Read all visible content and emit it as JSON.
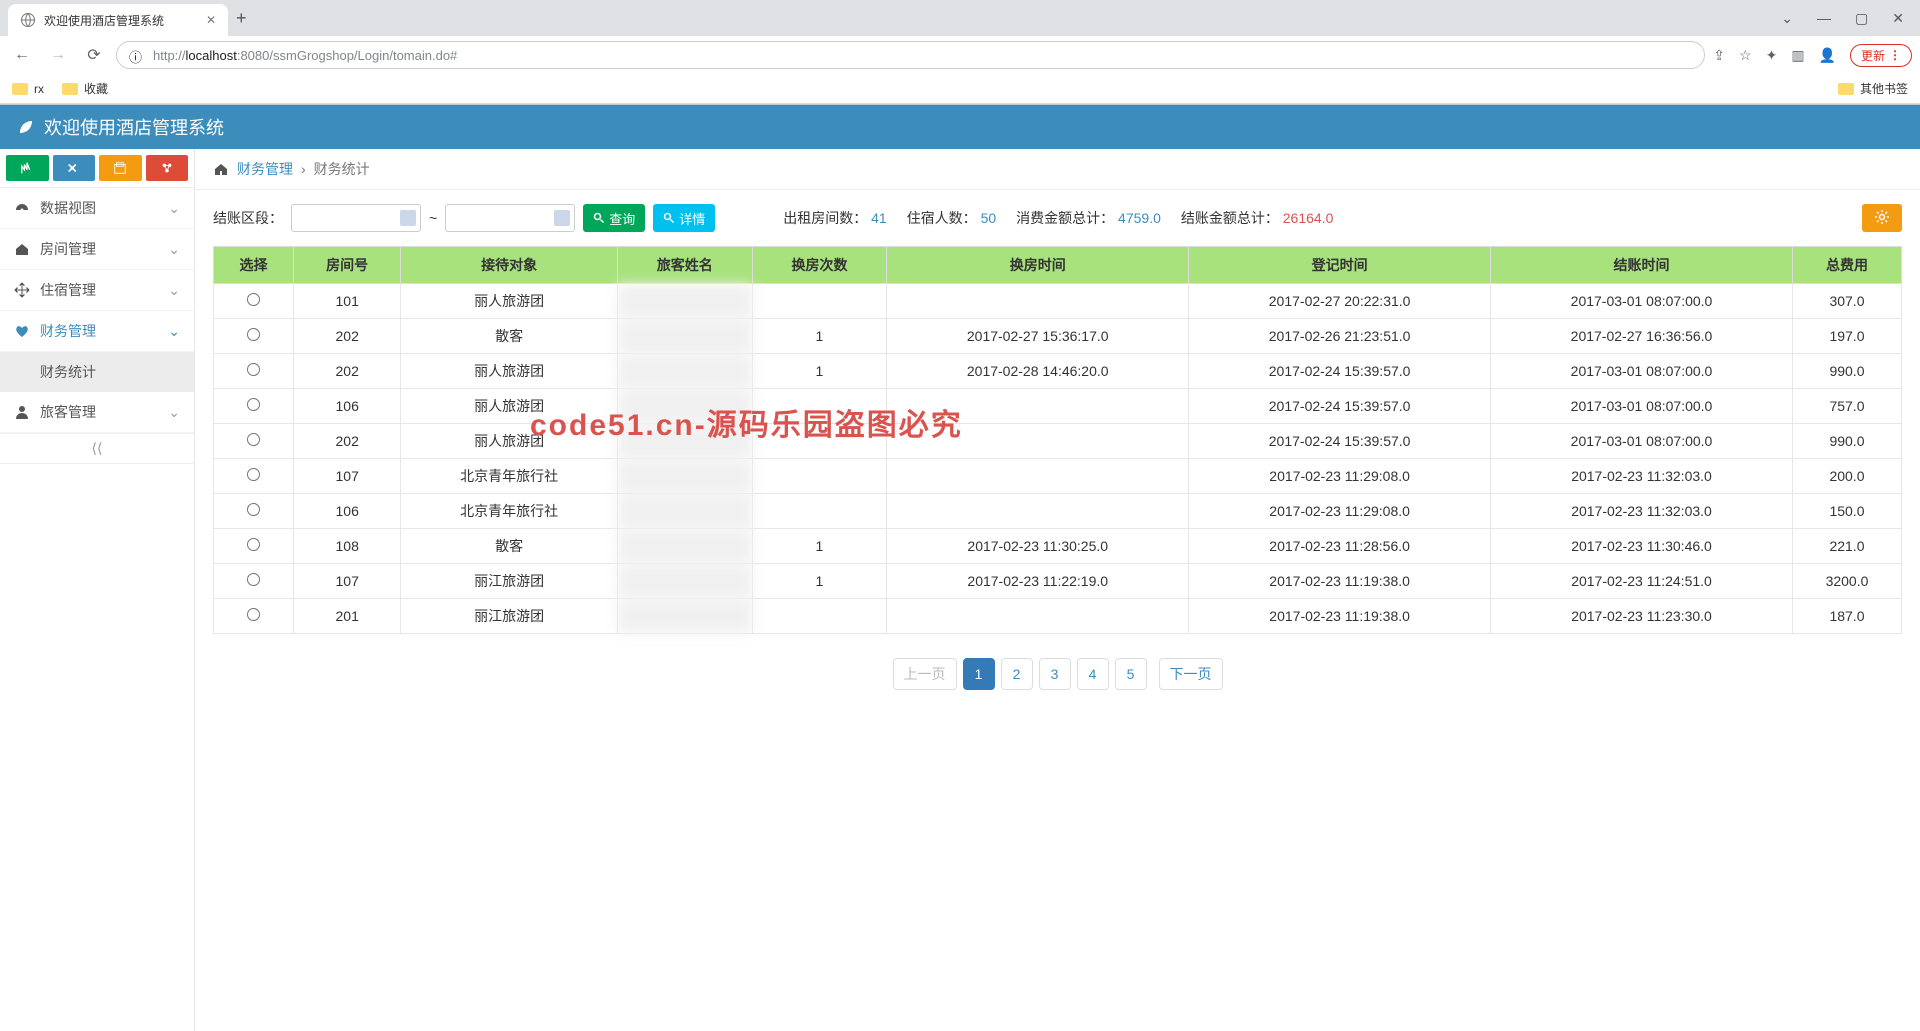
{
  "browser": {
    "tab_title": "欢迎使用酒店管理系统",
    "url_host": "localhost",
    "url_port": ":8080",
    "url_path": "/ssmGrogshop/Login/tomain.do#",
    "url_prefix": "http://",
    "update_label": "更新",
    "bookmarks": {
      "rx": "rx",
      "fav": "收藏",
      "other": "其他书签"
    }
  },
  "app_title": "欢迎使用酒店管理系统",
  "breadcrumb": {
    "l1": "财务管理",
    "l2": "财务统计"
  },
  "sidebar": {
    "items": [
      {
        "label": "数据视图"
      },
      {
        "label": "房间管理"
      },
      {
        "label": "住宿管理"
      },
      {
        "label": "财务管理"
      },
      {
        "label": "旅客管理"
      }
    ],
    "sub_finance": "财务统计"
  },
  "filter": {
    "period_label": "结账区段：",
    "tilde": "~",
    "search": "查询",
    "detail": "详情"
  },
  "stats": {
    "rooms_label": "出租房间数：",
    "rooms": "41",
    "guests_label": "住宿人数：",
    "guests": "50",
    "consume_label": "消费金额总计：",
    "consume": "4759.0",
    "settle_label": "结账金额总计：",
    "settle": "26164.0"
  },
  "table": {
    "headers": [
      "选择",
      "房间号",
      "接待对象",
      "旅客姓名",
      "换房次数",
      "换房时间",
      "登记时间",
      "结账时间",
      "总费用"
    ],
    "rows": [
      {
        "room": "101",
        "obj": "丽人旅游团",
        "name": "",
        "chg": "",
        "chgt": "",
        "reg": "2017-02-27 20:22:31.0",
        "set": "2017-03-01 08:07:00.0",
        "fee": "307.0"
      },
      {
        "room": "202",
        "obj": "散客",
        "name": "",
        "chg": "1",
        "chgt": "2017-02-27 15:36:17.0",
        "reg": "2017-02-26 21:23:51.0",
        "set": "2017-02-27 16:36:56.0",
        "fee": "197.0"
      },
      {
        "room": "202",
        "obj": "丽人旅游团",
        "name": "",
        "chg": "1",
        "chgt": "2017-02-28 14:46:20.0",
        "reg": "2017-02-24 15:39:57.0",
        "set": "2017-03-01 08:07:00.0",
        "fee": "990.0"
      },
      {
        "room": "106",
        "obj": "丽人旅游团",
        "name": "",
        "chg": "",
        "chgt": "",
        "reg": "2017-02-24 15:39:57.0",
        "set": "2017-03-01 08:07:00.0",
        "fee": "757.0"
      },
      {
        "room": "202",
        "obj": "丽人旅游团",
        "name": "",
        "chg": "",
        "chgt": "",
        "reg": "2017-02-24 15:39:57.0",
        "set": "2017-03-01 08:07:00.0",
        "fee": "990.0"
      },
      {
        "room": "107",
        "obj": "北京青年旅行社",
        "name": "",
        "chg": "",
        "chgt": "",
        "reg": "2017-02-23 11:29:08.0",
        "set": "2017-02-23 11:32:03.0",
        "fee": "200.0"
      },
      {
        "room": "106",
        "obj": "北京青年旅行社",
        "name": "",
        "chg": "",
        "chgt": "",
        "reg": "2017-02-23 11:29:08.0",
        "set": "2017-02-23 11:32:03.0",
        "fee": "150.0"
      },
      {
        "room": "108",
        "obj": "散客",
        "name": "",
        "chg": "1",
        "chgt": "2017-02-23 11:30:25.0",
        "reg": "2017-02-23 11:28:56.0",
        "set": "2017-02-23 11:30:46.0",
        "fee": "221.0"
      },
      {
        "room": "107",
        "obj": "丽江旅游团",
        "name": "",
        "chg": "1",
        "chgt": "2017-02-23 11:22:19.0",
        "reg": "2017-02-23 11:19:38.0",
        "set": "2017-02-23 11:24:51.0",
        "fee": "3200.0"
      },
      {
        "room": "201",
        "obj": "丽江旅游团",
        "name": "",
        "chg": "",
        "chgt": "",
        "reg": "2017-02-23 11:19:38.0",
        "set": "2017-02-23 11:23:30.0",
        "fee": "187.0"
      }
    ]
  },
  "pagination": {
    "prev": "上一页",
    "next": "下一页",
    "pages": [
      "1",
      "2",
      "3",
      "4",
      "5"
    ],
    "active": "1"
  },
  "watermark": "code51.cn-源码乐园盗图必究"
}
